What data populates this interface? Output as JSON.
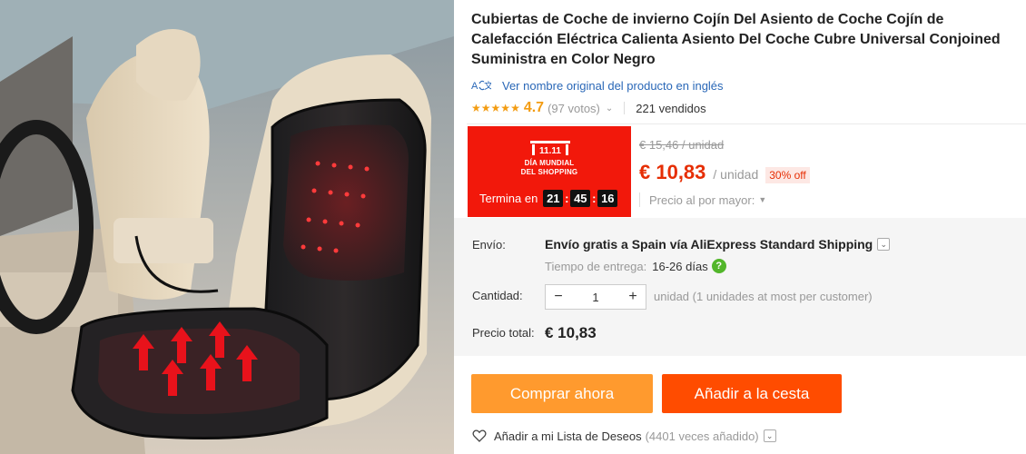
{
  "product": {
    "title": "Cubiertas de Coche de invierno Cojín Del Asiento de Coche Cojín de Calefacción Eléctrica Calienta Asiento Del Coche Cubre Universal Conjoined Suministra en Color Negro",
    "translate_link": "Ver nombre original del producto en inglés",
    "rating_value": "4.7",
    "votes": "(97 votos)",
    "sold": "221 vendidos"
  },
  "promo": {
    "logo_text": "11.11",
    "name_line1": "DÍA MUNDIAL",
    "name_line2": "DEL SHOPPING",
    "countdown_label": "Termina en",
    "hours": "21",
    "minutes": "45",
    "seconds": "16"
  },
  "pricing": {
    "old_price": "€ 15,46 / unidad",
    "price": "€ 10,83",
    "per_unit": "/ unidad",
    "discount": "30% off",
    "bulk_label": "Precio al por mayor:"
  },
  "shipping": {
    "label": "Envío:",
    "main": "Envío gratis a Spain vía AliExpress Standard Shipping",
    "delivery_label": "Tiempo de entrega:",
    "delivery_value": "16-26 días"
  },
  "quantity": {
    "label": "Cantidad:",
    "value": "1",
    "note": "unidad (1 unidades at most per customer)"
  },
  "total": {
    "label": "Precio total:",
    "value": "€ 10,83"
  },
  "actions": {
    "buy_now": "Comprar ahora",
    "add_to_cart": "Añadir a la cesta"
  },
  "wishlist": {
    "label": "Añadir a mi Lista de Deseos",
    "count": "(4401 veces añadido)"
  },
  "colors": {
    "accent_red": "#e62e04",
    "promo_red": "#f2180b",
    "buy_orange": "#ff9a2e",
    "cart_orange": "#ff4c00",
    "star": "#f39c12",
    "link_blue": "#2967b7"
  },
  "icons": {
    "translate": "translate-icon",
    "star": "star-icon",
    "help": "help-icon",
    "heart": "heart-icon"
  }
}
